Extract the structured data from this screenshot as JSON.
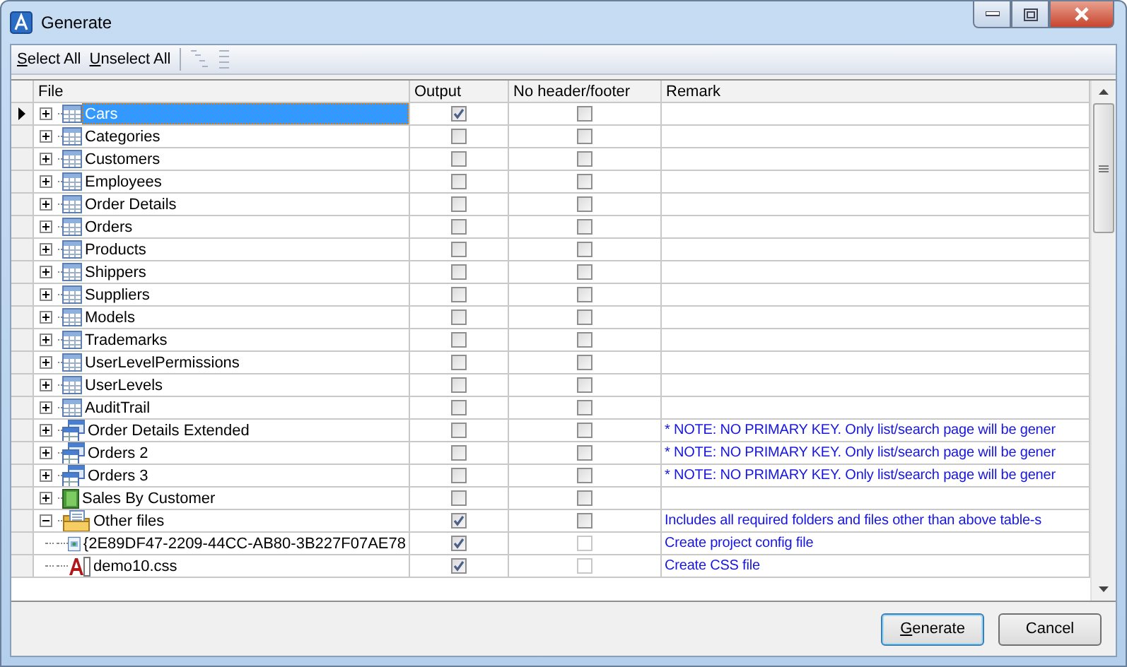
{
  "window": {
    "title": "Generate"
  },
  "toolbar": [
    {
      "label": "Select All"
    },
    {
      "label": "Unselect All"
    }
  ],
  "columns": [
    "File",
    "Output",
    "No header/footer",
    "Remark"
  ],
  "rows": [
    {
      "name": "Cars",
      "kind": "table",
      "selected": true,
      "expanded": false,
      "output": true,
      "no_header": false
    },
    {
      "name": "Categories",
      "kind": "table",
      "selected": false,
      "expanded": false,
      "output": false,
      "no_header": false
    },
    {
      "name": "Customers",
      "kind": "table",
      "selected": false,
      "expanded": false,
      "output": false,
      "no_header": false
    },
    {
      "name": "Employees",
      "kind": "table",
      "selected": false,
      "expanded": false,
      "output": false,
      "no_header": false
    },
    {
      "name": "Order Details",
      "kind": "table",
      "selected": false,
      "expanded": false,
      "output": false,
      "no_header": false
    },
    {
      "name": "Orders",
      "kind": "table",
      "selected": false,
      "expanded": false,
      "output": false,
      "no_header": false
    },
    {
      "name": "Products",
      "kind": "table",
      "selected": false,
      "expanded": false,
      "output": false,
      "no_header": false
    },
    {
      "name": "Shippers",
      "kind": "table",
      "selected": false,
      "expanded": false,
      "output": false,
      "no_header": false
    },
    {
      "name": "Suppliers",
      "kind": "table",
      "selected": false,
      "expanded": false,
      "output": false,
      "no_header": false
    },
    {
      "name": "Models",
      "kind": "table",
      "selected": false,
      "expanded": false,
      "output": false,
      "no_header": false
    },
    {
      "name": "Trademarks",
      "kind": "table",
      "selected": false,
      "expanded": false,
      "output": false,
      "no_header": false
    },
    {
      "name": "UserLevelPermissions",
      "kind": "table",
      "selected": false,
      "expanded": false,
      "output": false,
      "no_header": false
    },
    {
      "name": "UserLevels",
      "kind": "table",
      "selected": false,
      "expanded": false,
      "output": false,
      "no_header": false
    },
    {
      "name": "AuditTrail",
      "kind": "table",
      "selected": false,
      "expanded": false,
      "output": false,
      "no_header": false
    },
    {
      "name": "Order Details Extended",
      "kind": "view",
      "selected": false,
      "expanded": false,
      "output": false,
      "no_header": false,
      "remark": "* NOTE: NO PRIMARY KEY. Only list/search page will be gener"
    },
    {
      "name": "Orders 2",
      "kind": "view",
      "selected": false,
      "expanded": false,
      "output": false,
      "no_header": false,
      "remark": "* NOTE: NO PRIMARY KEY. Only list/search page will be gener"
    },
    {
      "name": "Orders 3",
      "kind": "view",
      "selected": false,
      "expanded": false,
      "output": false,
      "no_header": false,
      "remark": "* NOTE: NO PRIMARY KEY. Only list/search page will be gener"
    },
    {
      "name": "Sales By Customer",
      "kind": "report",
      "selected": false,
      "expanded": false,
      "output": false,
      "no_header": false
    },
    {
      "name": "Other files",
      "kind": "folder",
      "selected": false,
      "expanded": true,
      "output": true,
      "no_header": false,
      "remark": "Includes all required folders and files other than above table-s",
      "children": [
        {
          "name": "{2E89DF47-2209-44CC-AB80-3B227F07AE78",
          "kind": "config",
          "selected": false,
          "output": true,
          "no_header": false,
          "no_header_disabled": true,
          "remark": "Create project config file"
        },
        {
          "name": "demo10.css",
          "kind": "css",
          "selected": false,
          "output": true,
          "no_header": false,
          "no_header_disabled": true,
          "remark": "Create CSS file"
        }
      ]
    }
  ],
  "buttons": [
    {
      "label": "Generate",
      "default": true
    },
    {
      "label": "Cancel",
      "default": false
    }
  ]
}
